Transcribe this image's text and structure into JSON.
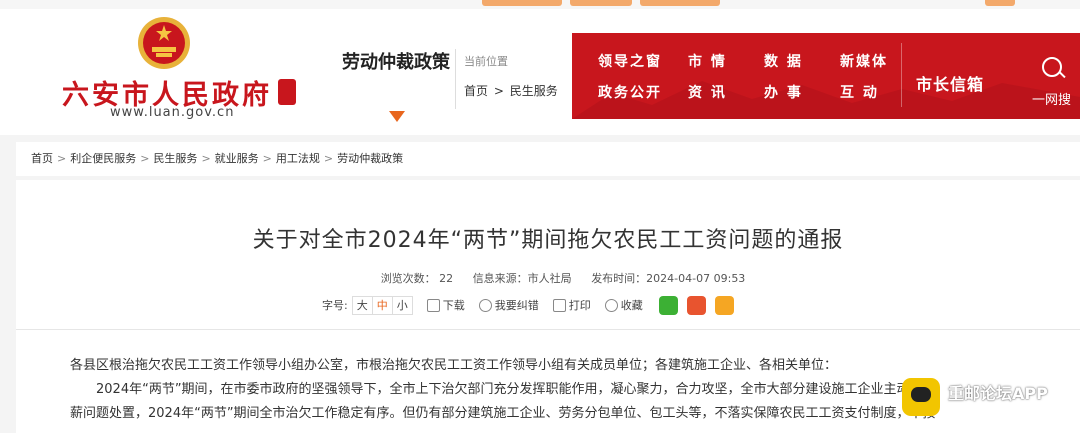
{
  "header": {
    "site_name": "六安市人民政府",
    "site_url": "www.luan.gov.cn",
    "section_title": "劳动仲裁政策",
    "current_location_label": "当前位置",
    "current_path": [
      "首页",
      "民生服务"
    ],
    "nav": [
      {
        "label": "领导之窗"
      },
      {
        "label": "市 情"
      },
      {
        "label": "数 据"
      },
      {
        "label": "新媒体"
      },
      {
        "label": "政务公开"
      },
      {
        "label": "资 讯"
      },
      {
        "label": "办 事"
      },
      {
        "label": "互 动"
      }
    ],
    "mayor_mailbox": "市长信箱",
    "search_label": "一网搜"
  },
  "breadcrumb": [
    "首页",
    "利企便民服务",
    "民生服务",
    "就业服务",
    "用工法规",
    "劳动仲裁政策"
  ],
  "breadcrumb_separator": ">",
  "article": {
    "title": "关于对全市2024年“两节”期间拖欠农民工工资问题的通报",
    "views": "浏览次数： 22",
    "source": "信息来源：市人社局",
    "published": "发布时间：2024-04-07 09:53",
    "font_size_label": "字号:",
    "font_sizes": [
      "大",
      "中",
      "小"
    ],
    "tools": [
      "下载",
      "我要纠错",
      "打印",
      "收藏"
    ],
    "paragraphs": [
      "各县区根治拖欠农民工工资工作领导小组办公室，市根治拖欠农民工工资工作领导小组有关成员单位；各建筑施工企业、各相关单位：",
      "2024年“两节”期间，在市委市政府的坚强领导下，全市上下治欠部门充分发挥职能作用，凝心聚力，合力攻坚，全市大部分建设施工企业主动承担",
      "薪问题处置，2024年“两节”期间全市治欠工作稳定有序。但仍有部分建筑施工企业、劳务分包单位、包工头等，不落实保障农民工工资支付制度，不按"
    ]
  },
  "watermark": {
    "text": "重邮论坛APP"
  },
  "colors": {
    "brand_red": "#c8161d",
    "accent_orange": "#e8661e",
    "share_wechat": "#3cb034",
    "share_weibo": "#e8542f",
    "share_favorite": "#f5a623"
  }
}
